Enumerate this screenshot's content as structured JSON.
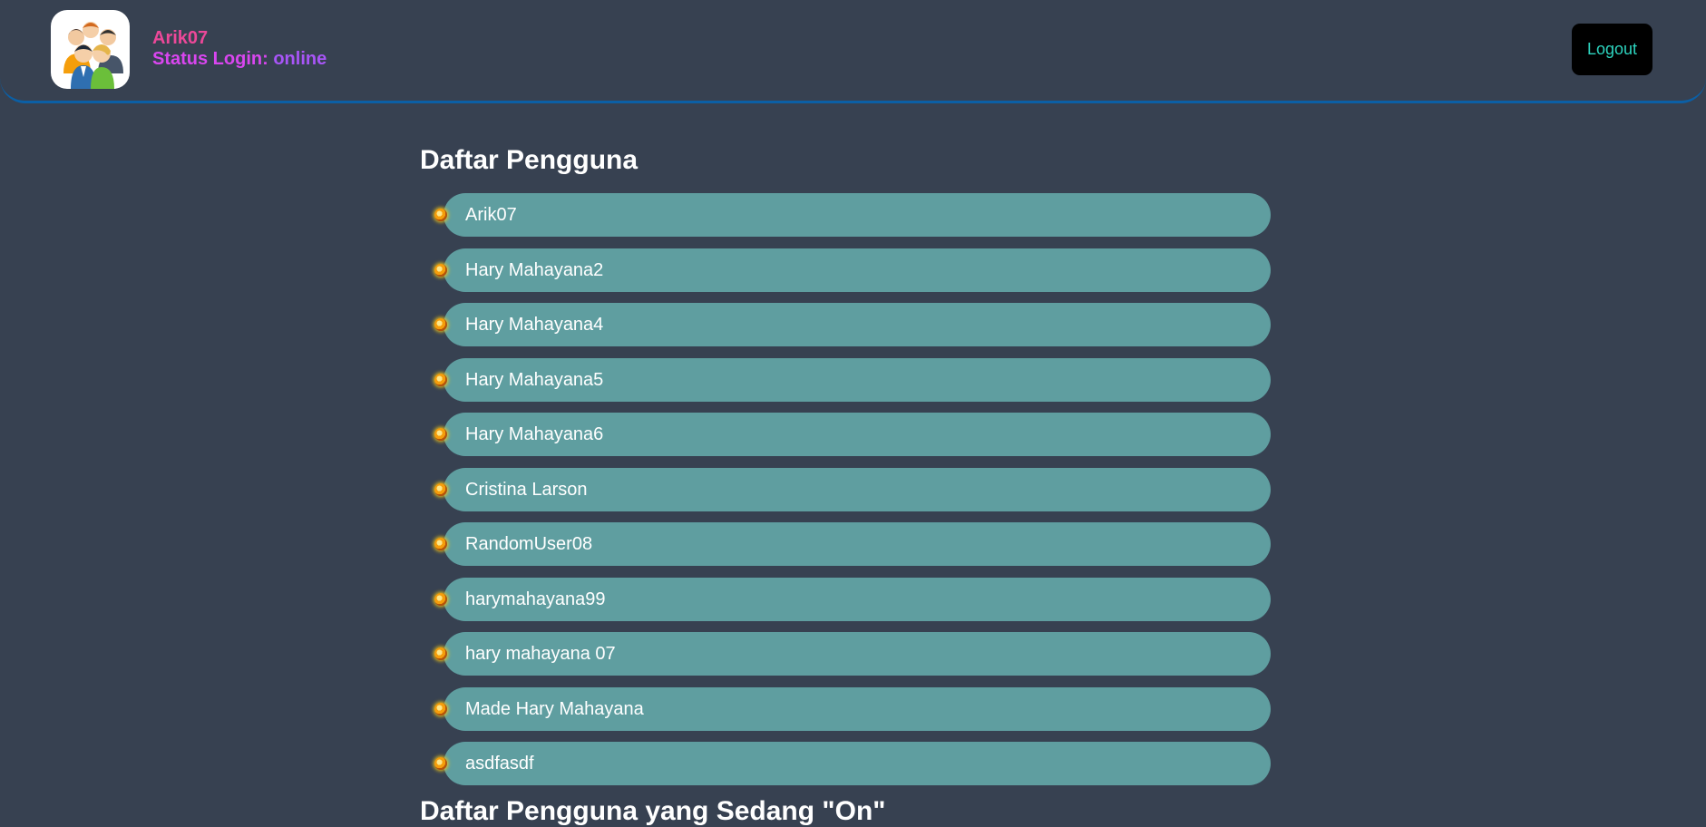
{
  "header": {
    "avatar_icon": "group-users-icon",
    "username": "Arik07",
    "status_label": "Status Login: ",
    "status_value": "online",
    "logout_label": "Logout"
  },
  "colors": {
    "background": "#374151",
    "header_border": "#0b5fa5",
    "username": "#ec4899",
    "status_label": "#d946ef",
    "status_value": "#a855f7",
    "logout_bg": "#000000",
    "logout_text": "#2dd4bf",
    "list_item_bg": "#5f9ea0"
  },
  "main": {
    "users_title": "Daftar Pengguna",
    "users": [
      "Arik07",
      "Hary Mahayana2",
      "Hary Mahayana4",
      "Hary Mahayana5",
      "Hary Mahayana6",
      "Cristina Larson",
      "RandomUser08",
      "harymahayana99",
      "hary mahayana 07",
      "Made Hary Mahayana",
      "asdfasdf"
    ],
    "bullet_icon": "cookie-bullet-icon",
    "online_title": "Daftar Pengguna yang Sedang \"On\""
  }
}
